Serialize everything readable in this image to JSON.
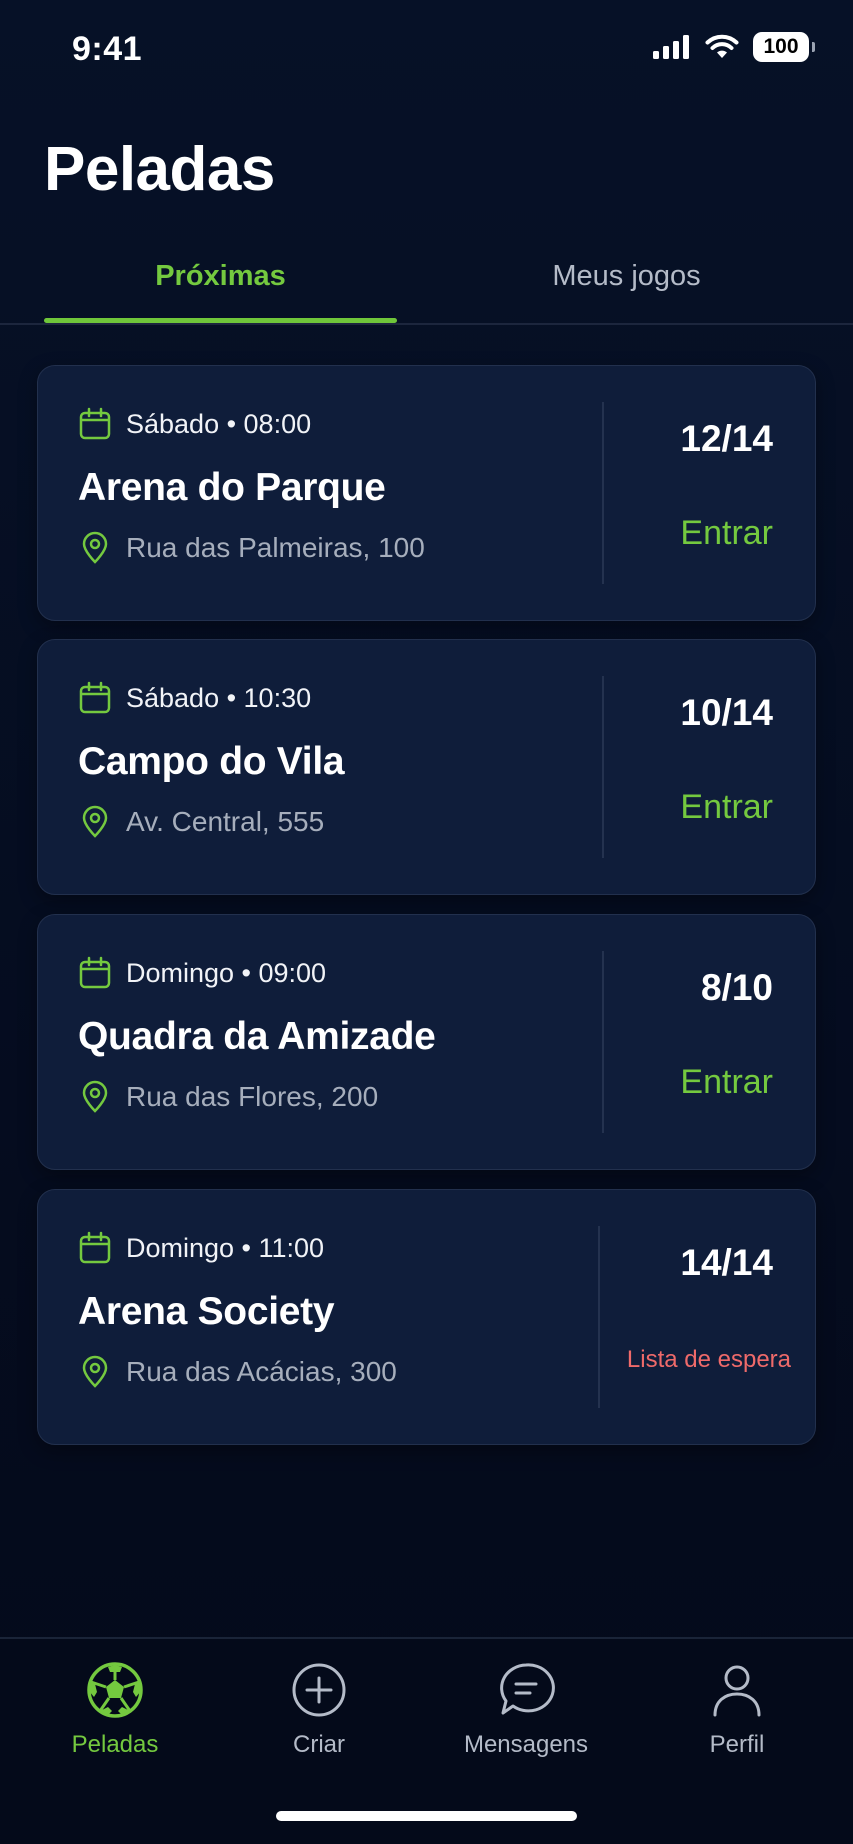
{
  "status_bar": {
    "time": "9:41",
    "battery": "100"
  },
  "page": {
    "title": "Peladas"
  },
  "tabs": [
    {
      "label": "Próximas",
      "active": true
    },
    {
      "label": "Meus jogos",
      "active": false
    }
  ],
  "games": [
    {
      "when": "Sábado • 08:00",
      "name": "Arena do Parque",
      "address": "Rua das Palmeiras, 100",
      "count": "12/14",
      "action": "Entrar",
      "status": "open"
    },
    {
      "when": "Sábado • 10:30",
      "name": "Campo do Vila",
      "address": "Av. Central, 555",
      "count": "10/14",
      "action": "Entrar",
      "status": "open"
    },
    {
      "when": "Domingo • 09:00",
      "name": "Quadra da Amizade",
      "address": "Rua das Flores, 200",
      "count": "8/10",
      "action": "Entrar",
      "status": "open"
    },
    {
      "when": "Domingo • 11:00",
      "name": "Arena Society",
      "address": "Rua das Acácias, 300",
      "count": "14/14",
      "action": "Lista de espera",
      "status": "waitlist"
    }
  ],
  "bottom_nav": [
    {
      "label": "Peladas",
      "icon": "soccer-ball-icon",
      "active": true
    },
    {
      "label": "Criar",
      "icon": "plus-circle-icon",
      "active": false
    },
    {
      "label": "Mensagens",
      "icon": "chat-icon",
      "active": false
    },
    {
      "label": "Perfil",
      "icon": "user-icon",
      "active": false
    }
  ],
  "colors": {
    "accent": "#74c93f",
    "waitlist": "#ef6a6a",
    "card": "#0f1d3a",
    "background": "#050b1d"
  }
}
